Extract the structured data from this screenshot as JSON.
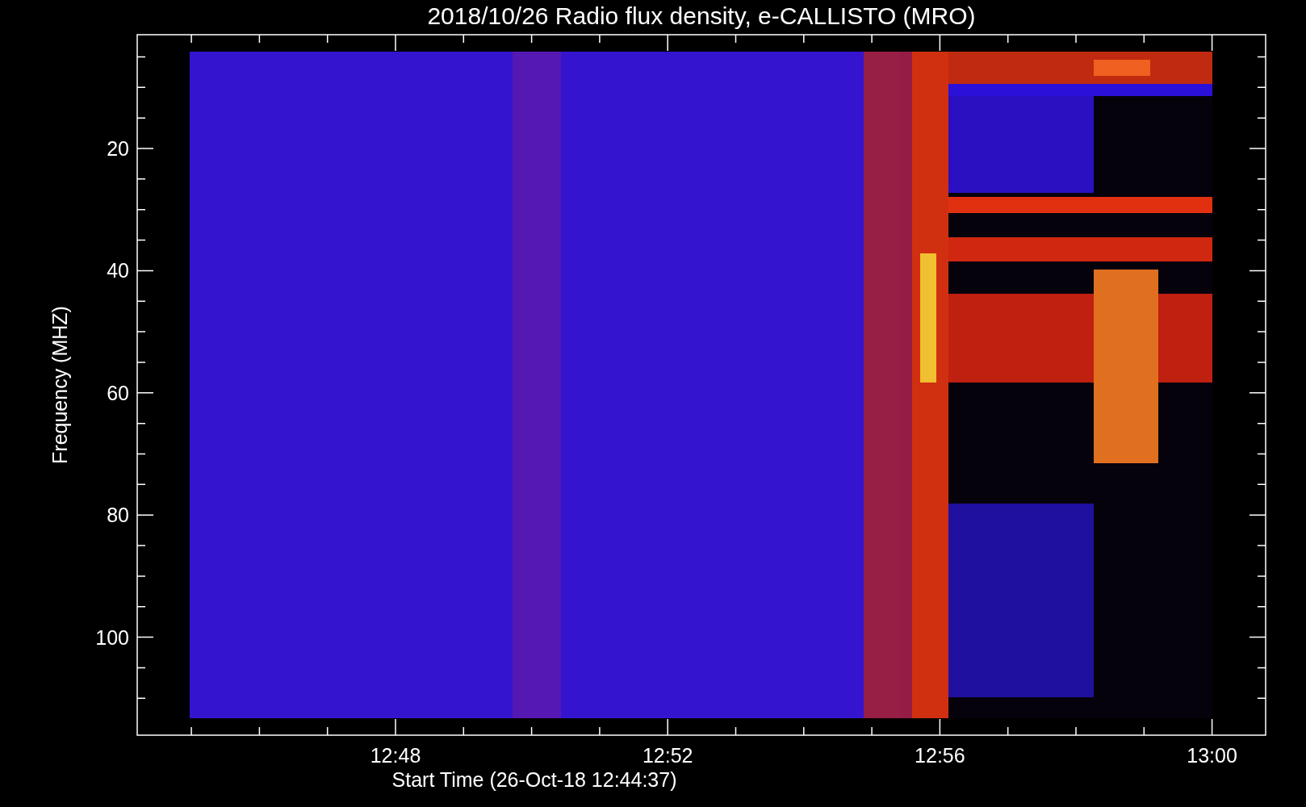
{
  "title": "2018/10/26  Radio flux density, e-CALLISTO (MRO)",
  "y_axis": {
    "label": "Frequency (MHZ)",
    "ticks": [
      "20",
      "40",
      "60",
      "80",
      "100"
    ]
  },
  "x_axis": {
    "label": "Start Time (26-Oct-18 12:44:37)",
    "ticks": [
      "12:48",
      "12:52",
      "12:56",
      "13:00"
    ]
  }
}
